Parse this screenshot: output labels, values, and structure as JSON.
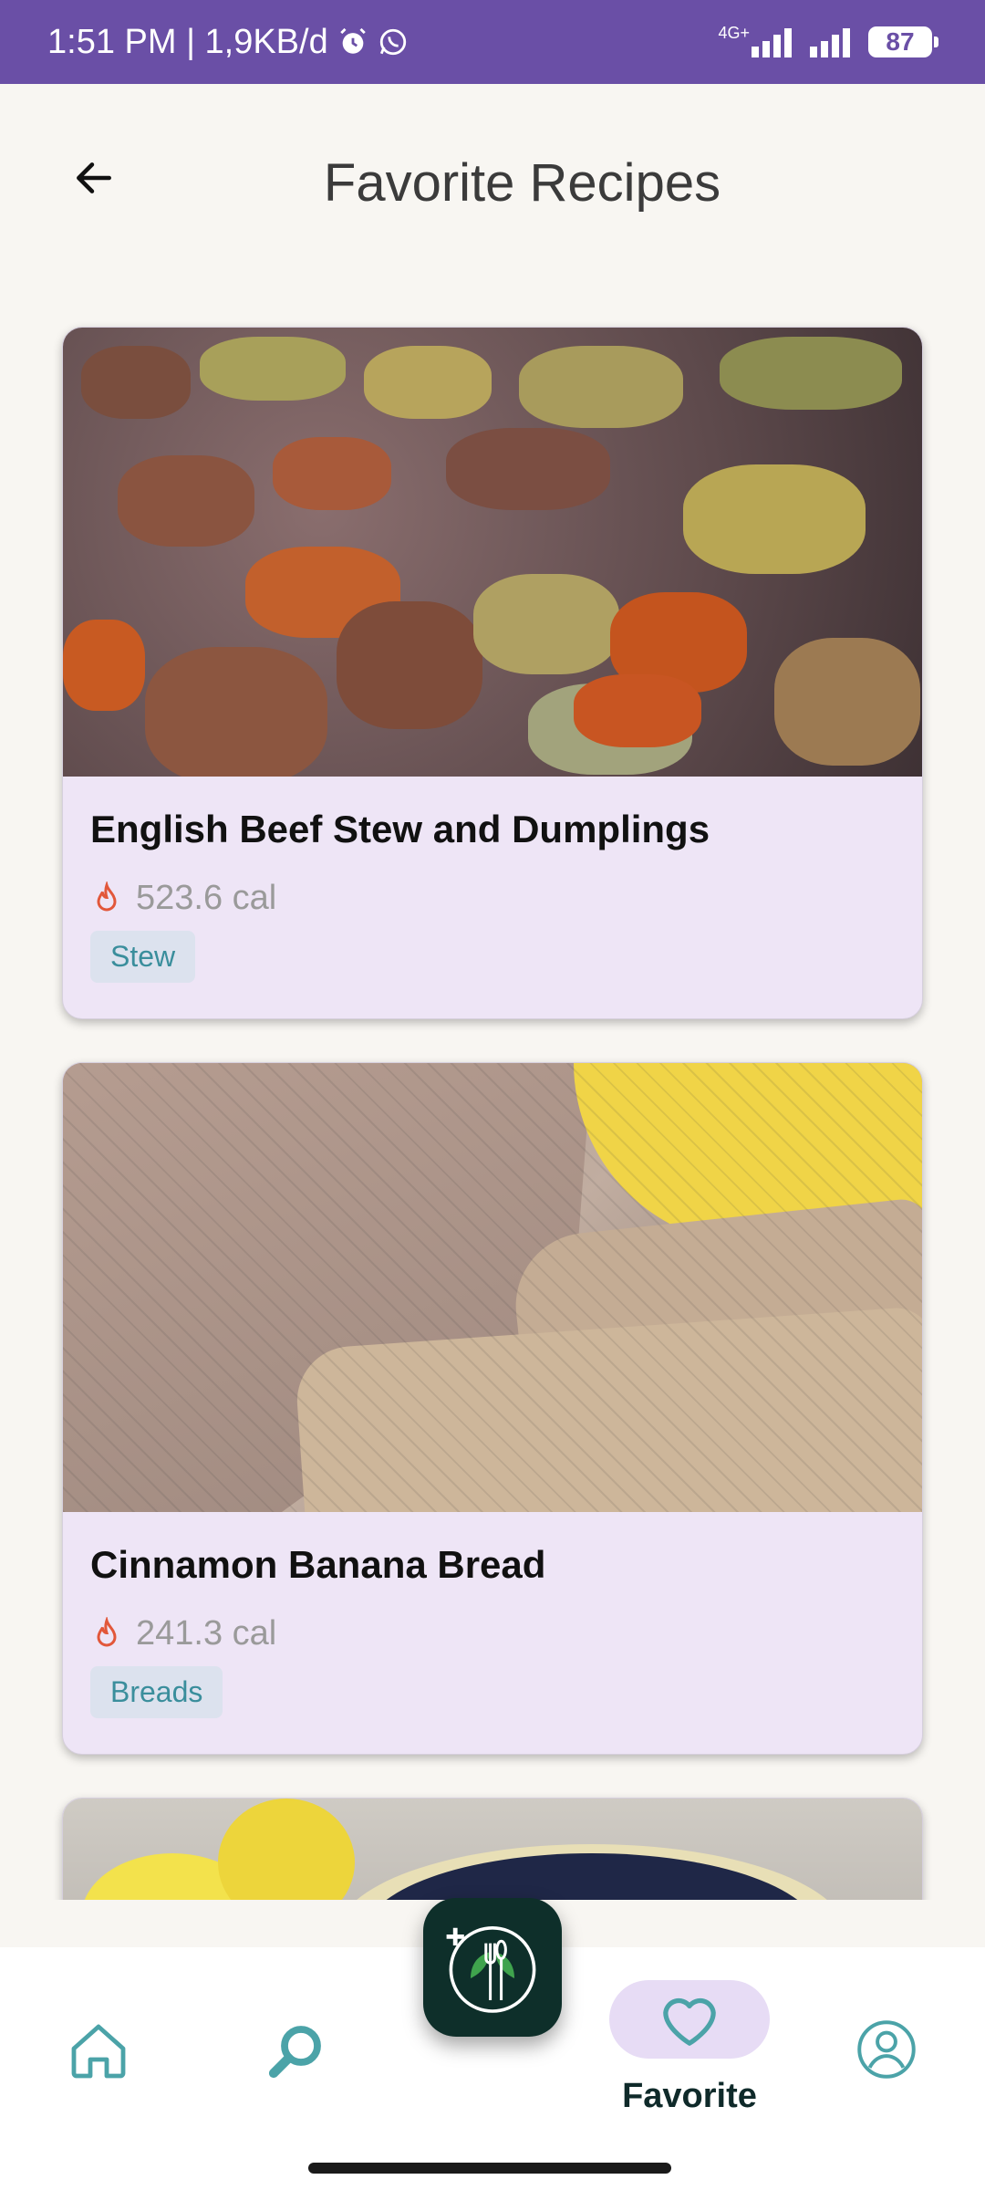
{
  "status_bar": {
    "time": "1:51 PM | 1,9KB/d",
    "network_type": "4G+",
    "battery": "87"
  },
  "header": {
    "title": "Favorite Recipes"
  },
  "recipes": [
    {
      "name": "English Beef Stew and Dumplings",
      "calories": "523.6 cal",
      "category": "Stew"
    },
    {
      "name": "Cinnamon Banana Bread",
      "calories": "241.3 cal",
      "category": "Breads"
    }
  ],
  "bottom_nav": {
    "active_label": "Favorite",
    "items": [
      "home-icon",
      "search-icon",
      "app-logo",
      "heart-icon",
      "profile-icon"
    ]
  },
  "colors": {
    "status_bar": "#6A4FA6",
    "accent": "#4BA3A8",
    "card_bg": "#EEE5F6",
    "fab_bg": "#0E2F2A",
    "fire": "#E2573A"
  }
}
